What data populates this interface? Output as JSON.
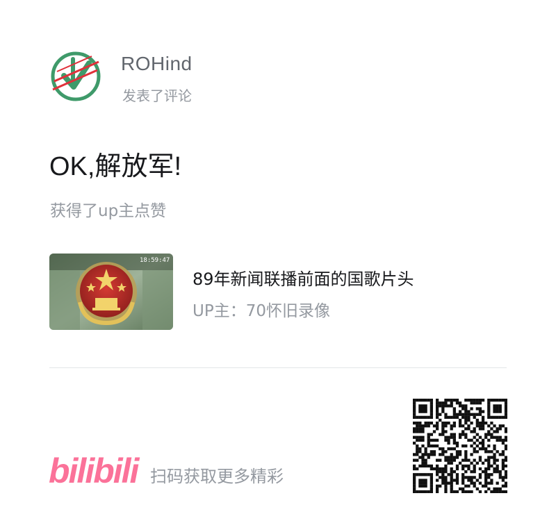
{
  "user": {
    "name": "ROHind",
    "action": "发表了评论",
    "avatar": "dislike-badge-icon"
  },
  "comment": {
    "text": "OK,解放军!",
    "liked_note": "获得了up主点赞"
  },
  "video": {
    "title": "89年新闻联播前面的国歌片头",
    "uploader": "UP主：70怀旧录像",
    "thumbnail_timestamp": "18:59:47",
    "thumbnail": "national-emblem-thumbnail"
  },
  "footer": {
    "brand": "bilibili",
    "slogan": "扫码获取更多精彩",
    "qr": "qr-code"
  },
  "colors": {
    "brand_pink": "#fb7299",
    "avatar_green": "#3f9a6a",
    "avatar_red": "#e0303a",
    "text_primary": "#18191c",
    "text_secondary": "#9499a0"
  }
}
